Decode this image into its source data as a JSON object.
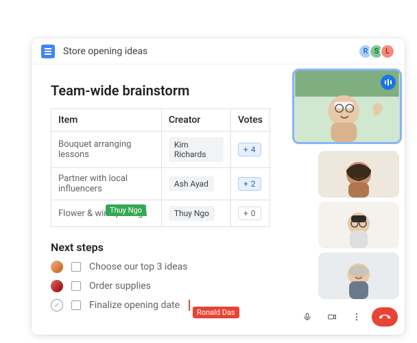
{
  "doc": {
    "title": "Store opening ideas"
  },
  "presence": [
    {
      "initial": "R",
      "color": "#4285F4"
    },
    {
      "initial": "S",
      "color": "#34A853"
    },
    {
      "initial": "L",
      "color": "#EA4335"
    }
  ],
  "section1_heading": "Team-wide brainstorm",
  "table": {
    "headers": {
      "item": "Item",
      "creator": "Creator",
      "votes": "Votes"
    },
    "rows": [
      {
        "item": "Bouquet arranging lessons",
        "creator": "Kim Richards",
        "votes": 4,
        "highlighted": true
      },
      {
        "item": "Partner with local influencers",
        "creator": "Ash Ayad",
        "votes": 2,
        "highlighted": true
      },
      {
        "item": "Flower & wine pairings",
        "creator": "Thuy Ngo",
        "votes": 0,
        "highlighted": false
      }
    ]
  },
  "cursors": {
    "thuy": {
      "name": "Thuy Ngo",
      "color": "green"
    },
    "ronald": {
      "name": "Ronald Das",
      "color": "red"
    }
  },
  "section2_heading": "Next steps",
  "tasks": [
    {
      "label": "Choose our top 3 ideas",
      "avatar": "people1"
    },
    {
      "label": "Order supplies",
      "avatar": "people2"
    },
    {
      "label": "Finalize opening date",
      "avatar": "check"
    }
  ],
  "call": {
    "participants": 4,
    "controls": {
      "mic": "mic-icon",
      "camera": "video-icon",
      "more": "more-icon",
      "hangup": "hangup-icon"
    }
  }
}
